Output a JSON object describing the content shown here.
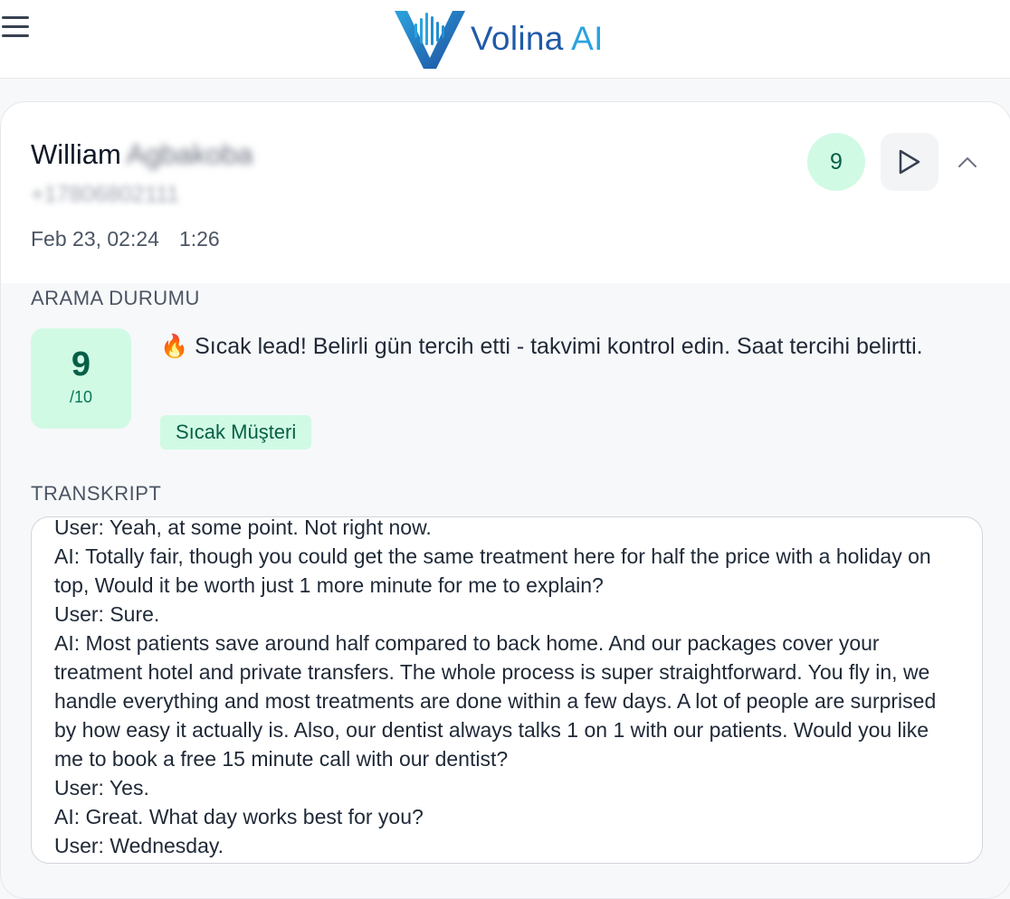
{
  "header": {
    "brand_main": "Volina",
    "brand_ai": "AI",
    "menu_icon": "hamburger-menu-icon"
  },
  "call": {
    "first_name": "William",
    "last_name": "Agbakoba",
    "phone": "+17806802111",
    "date": "Feb 23, 02:24",
    "duration": "1:26",
    "score": "9"
  },
  "status": {
    "label": "ARAMA DURUMU",
    "score": "9",
    "score_max": "/10",
    "summary_emoji": "🔥",
    "summary": "Sıcak lead! Belirli gün tercih etti - takvimi kontrol edin. Saat tercihi belirtti.",
    "tag": "Sıcak Müşteri"
  },
  "transcript": {
    "label": "TRANSKRIPT",
    "lines": [
      "User: Yeah, at some point. Not right now.",
      "AI: Totally fair, though you could get the same treatment here for half the price with a holiday on top, Would it be worth just 1 more minute for me to explain?",
      "User: Sure.",
      "AI: Most patients save around half compared to back home. And our packages cover your treatment hotel and private transfers. The whole process is super straightforward. You fly in, we handle everything and most treatments are done within a few days. A lot of people are surprised by how easy it actually is. Also, our dentist always talks 1 on 1 with our patients. Would you like me to book a free 15 minute call with our dentist?",
      "User: Yes.",
      "AI: Great. What day works best for you?",
      "User: Wednesday."
    ]
  },
  "colors": {
    "accent_green_bg": "#d1fae5",
    "accent_green_text": "#065f46",
    "brand_blue": "#1f5aa8",
    "brand_light_blue": "#2aa3df"
  }
}
